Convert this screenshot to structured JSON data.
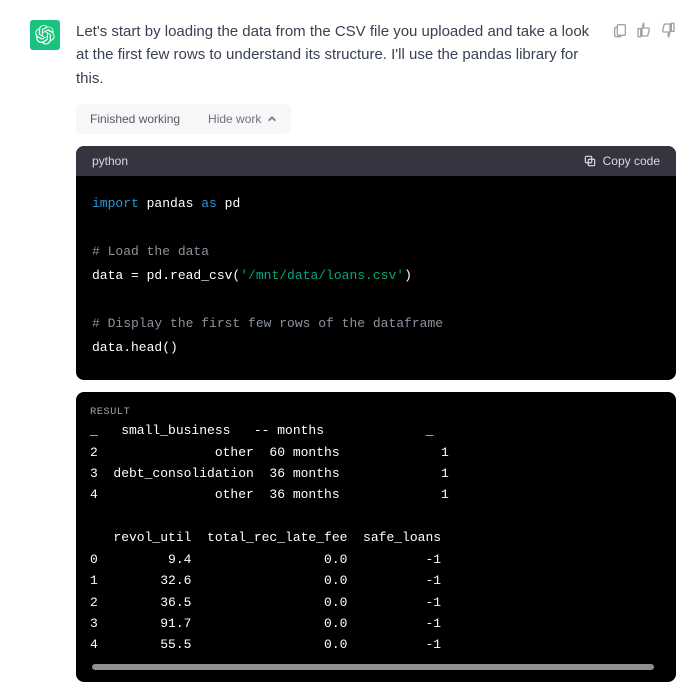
{
  "message": {
    "text": "Let's start by loading the data from the CSV file you uploaded and take a look at the first few rows to understand its structure. I'll use the pandas library for this."
  },
  "work_pill": {
    "status": "Finished working",
    "toggle": "Hide work"
  },
  "code": {
    "language": "python",
    "copy_label": "Copy code",
    "kw_import": "import",
    "mod_pandas": "pandas",
    "kw_as": "as",
    "alias_pd": "pd",
    "comment_load": "# Load the data",
    "assign_prefix": "data = pd.read_csv(",
    "path_str": "'/mnt/data/loans.csv'",
    "assign_suffix": ")",
    "comment_head": "# Display the first few rows of the dataframe",
    "head_call": "data.head()"
  },
  "result": {
    "label": "RESULT",
    "body": "_   small_business   -- months             _\n2               other  60 months             1\n3  debt_consolidation  36 months             1\n4               other  36 months             1\n\n   revol_util  total_rec_late_fee  safe_loans\n0         9.4                 0.0          -1\n1        32.6                 0.0          -1\n2        36.5                 0.0          -1\n3        91.7                 0.0          -1\n4        55.5                 0.0          -1"
  },
  "icons": {
    "clipboard": "clipboard-icon",
    "thumbs_up": "thumbs-up-icon",
    "thumbs_down": "thumbs-down-icon",
    "chevron_up": "chevron-up-icon",
    "copy": "copy-icon",
    "logo": "openai-logo-icon"
  }
}
